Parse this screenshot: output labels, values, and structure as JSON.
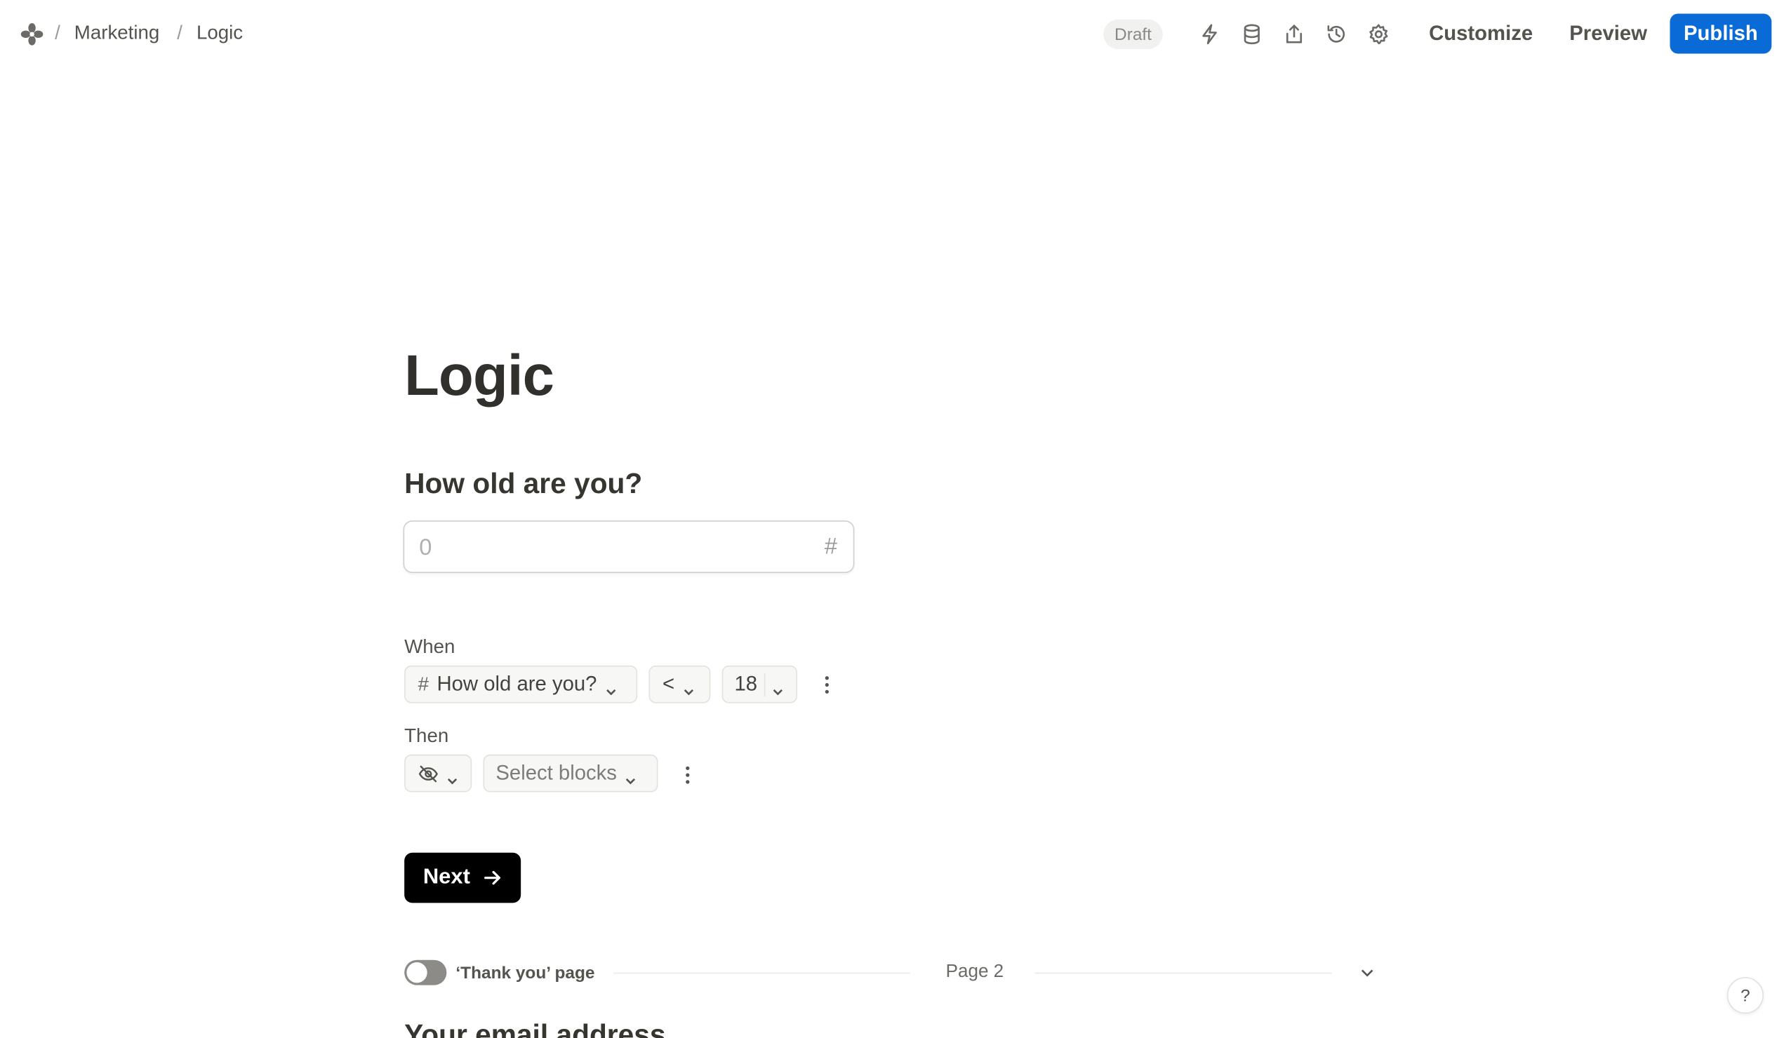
{
  "breadcrumb": {
    "logo_icon": "pinwheel-icon",
    "separator": "/",
    "items": [
      {
        "label": "Marketing"
      },
      {
        "label": "Logic"
      }
    ]
  },
  "toolbar": {
    "status_badge": "Draft",
    "icons": [
      "lightning-icon",
      "database-icon",
      "share-icon",
      "history-icon",
      "gear-icon"
    ],
    "customize_label": "Customize",
    "preview_label": "Preview",
    "publish_label": "Publish",
    "publish_color": "#0b6bd6"
  },
  "form": {
    "title": "Logic",
    "question": "How old are you?",
    "input_placeholder": "0",
    "input_type_icon": "#",
    "logic": {
      "when_label": "When",
      "condition": {
        "field_icon": "#",
        "field": "How old are you?",
        "operator": "<",
        "value": "18"
      },
      "then_label": "Then",
      "action": {
        "action_icon": "eye-off-icon",
        "target_placeholder": "Select blocks"
      }
    },
    "next_label": "Next"
  },
  "footer": {
    "thank_you_label": "‘Thank you’ page",
    "thank_you_enabled": false,
    "page_label": "Page 2",
    "next_section_title": "Your email address"
  },
  "help_label": "?"
}
